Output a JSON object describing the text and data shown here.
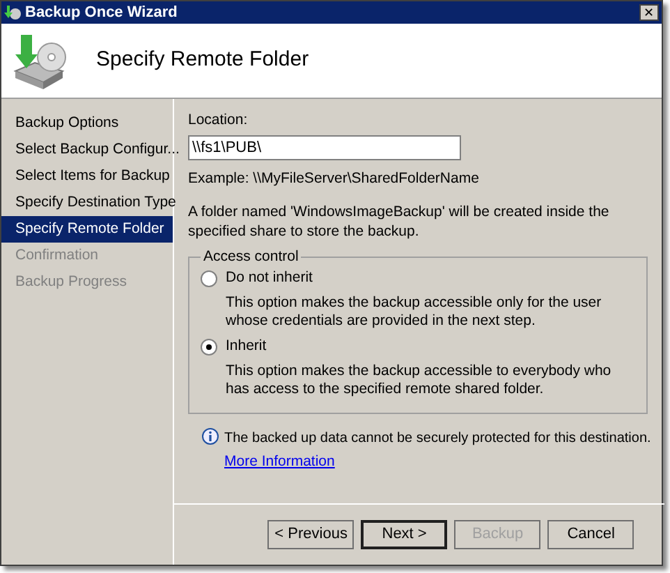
{
  "window": {
    "title": "Backup Once Wizard",
    "close": "✕"
  },
  "header": {
    "title": "Specify Remote Folder"
  },
  "sidebar": {
    "items": [
      {
        "label": "Backup Options",
        "selected": false,
        "disabled": false
      },
      {
        "label": "Select Backup Configur...",
        "selected": false,
        "disabled": false
      },
      {
        "label": "Select Items for Backup",
        "selected": false,
        "disabled": false
      },
      {
        "label": "Specify Destination Type",
        "selected": false,
        "disabled": false
      },
      {
        "label": "Specify Remote Folder",
        "selected": true,
        "disabled": false
      },
      {
        "label": "Confirmation",
        "selected": false,
        "disabled": true
      },
      {
        "label": "Backup Progress",
        "selected": false,
        "disabled": true
      }
    ]
  },
  "location": {
    "label": "Location:",
    "value": "\\\\fs1\\PUB\\",
    "example": "Example: \\\\MyFileServer\\SharedFolderName",
    "note": "A folder named 'WindowsImageBackup' will be created inside the specified share to store the backup."
  },
  "access_control": {
    "title": "Access control",
    "options": [
      {
        "label": "Do not inherit",
        "description": "This option makes the backup accessible only for the user whose credentials are provided in the next step.",
        "selected": false
      },
      {
        "label": "Inherit",
        "description": "This option makes the backup accessible to everybody who has access to the specified remote shared folder.",
        "selected": true
      }
    ]
  },
  "info": {
    "text": "The backed up data cannot be securely protected for this destination.",
    "link": "More Information"
  },
  "buttons": [
    {
      "label": "< Previous",
      "disabled": false,
      "default": false
    },
    {
      "label": "Next >",
      "disabled": false,
      "default": true
    },
    {
      "label": "Backup",
      "disabled": true,
      "default": false
    },
    {
      "label": "Cancel",
      "disabled": false,
      "default": false
    }
  ]
}
